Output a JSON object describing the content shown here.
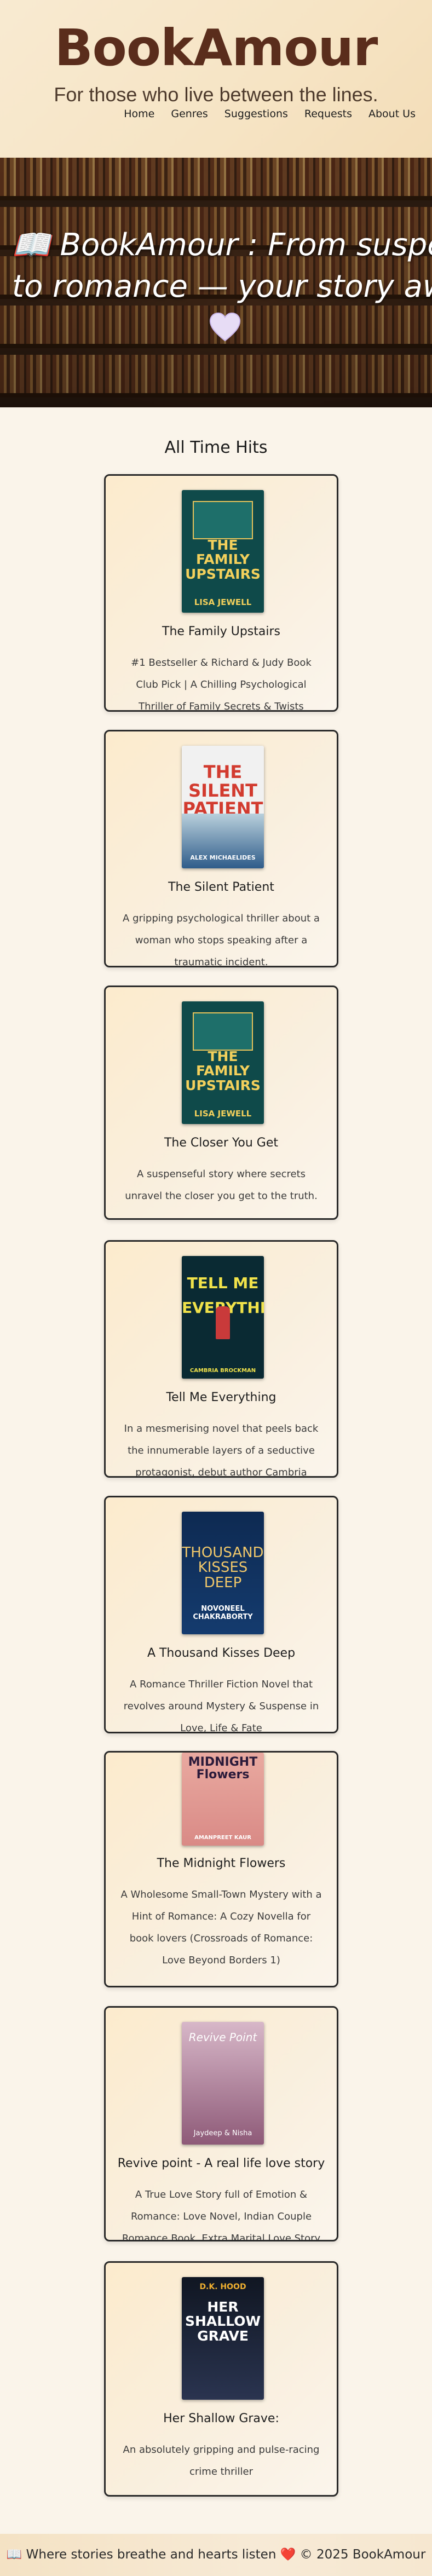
{
  "header": {
    "brand": "BookAmour",
    "tagline": "For those who live between the lines.",
    "nav": [
      "Home",
      "Genres",
      "Suggestions",
      "Requests",
      "About Us"
    ]
  },
  "hero": {
    "title_line1": "📖 BookAmour : From suspense",
    "title_line2": "to romance — your story awaits",
    "heart_icon": "purple-heart-icon"
  },
  "section": {
    "title": "All Time Hits"
  },
  "books": [
    {
      "title": "The Family Upstairs",
      "description": "#1 Bestseller & Richard & Judy Book Club Pick | A Chilling Psychological Thriller of Family Secrets & Twists",
      "cover_title": "THE FAMILY UPSTAIRS",
      "cover_author": "LISA JEWELL"
    },
    {
      "title": "The Silent Patient",
      "description": "A gripping psychological thriller about a woman who stops speaking after a traumatic incident.",
      "cover_title": "THE SILENT PATIENT",
      "cover_author": "ALEX MICHAELIDES"
    },
    {
      "title": "The Closer You Get",
      "description": "A suspenseful story where secrets unravel the closer you get to the truth.",
      "cover_title": "THE FAMILY UPSTAIRS",
      "cover_author": "LISA JEWELL"
    },
    {
      "title": "Tell Me Everything",
      "description": "In a mesmerising novel that peels back the innumerable layers of a seductive protagonist, debut author Cambria Brockman",
      "cover_title": "TELL ME EVERYTHING",
      "cover_author": "CAMBRIA BROCKMAN"
    },
    {
      "title": "A Thousand Kisses Deep",
      "description": "A Romance Thriller Fiction Novel that revolves around Mystery & Suspense in Love, Life & Fate",
      "cover_title": "THOUSAND KISSES DEEP",
      "cover_author": "NOVONEEL CHAKRABORTY"
    },
    {
      "title": "The Midnight Flowers",
      "description": "A Wholesome Small-Town Mystery with a Hint of Romance: A Cozy Novella for book lovers (Crossroads of Romance: Love Beyond Borders 1)",
      "cover_title": "MIDNIGHT Flowers",
      "cover_author": "AMANPREET KAUR"
    },
    {
      "title": "Revive point - A real life love story",
      "description": "A True Love Story full of Emotion & Romance: Love Novel, Indian Couple Romance Book, Extra Marital Love Story",
      "cover_title": "Revive Point",
      "cover_author": "Jaydeep & Nisha"
    },
    {
      "title": "Her Shallow Grave:",
      "description": "An absolutely gripping and pulse-racing crime thriller",
      "cover_title": "HER SHALLOW GRAVE",
      "cover_author": "D.K. HOOD"
    }
  ],
  "footer": {
    "text_before": "📖 Where stories breathe and hearts listen",
    "heart": "❤️",
    "text_after": "© 2025 BookAmour"
  }
}
